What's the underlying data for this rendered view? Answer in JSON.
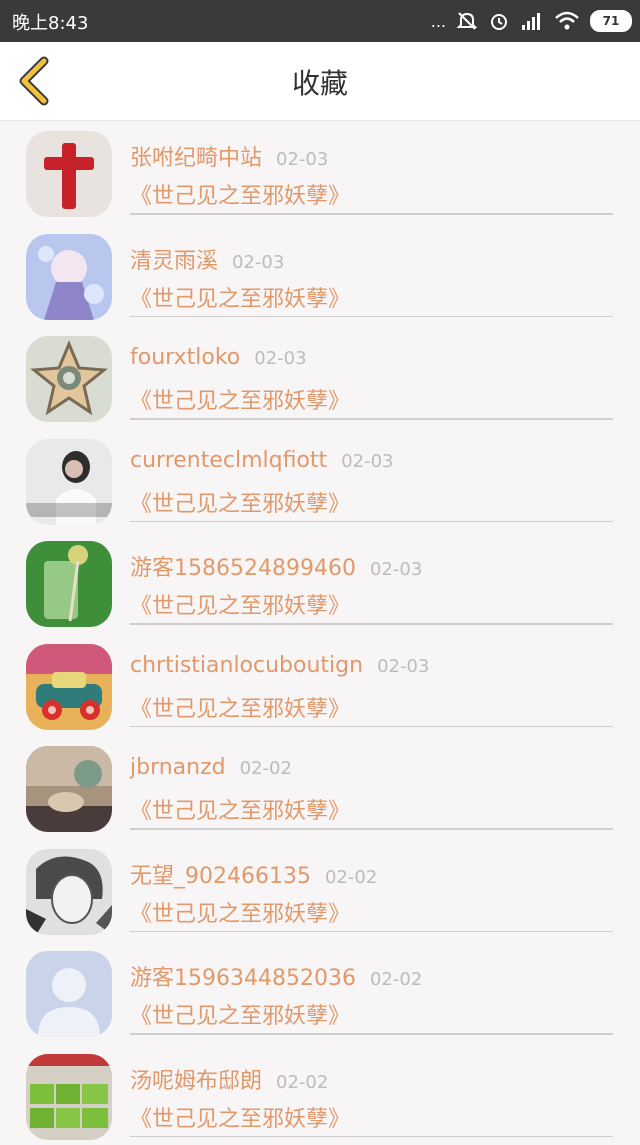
{
  "status_bar": {
    "time": "晚上8:43",
    "dots": "...",
    "battery": "71"
  },
  "header": {
    "title": "收藏"
  },
  "items": [
    {
      "name": "张咐纪畸中站",
      "date": "02-03",
      "book": "《世己见之至邪妖孽》",
      "avatar": "red-cross"
    },
    {
      "name": "清灵雨溪",
      "date": "02-03",
      "book": "《世己见之至邪妖孽》",
      "avatar": "anime-girl"
    },
    {
      "name": "fourxtloko",
      "date": "02-03",
      "book": "《世己见之至邪妖孽》",
      "avatar": "star-cookie"
    },
    {
      "name": "currenteclmlqfiott",
      "date": "02-03",
      "book": "《世己见之至邪妖孽》",
      "avatar": "woman-photo"
    },
    {
      "name": "游客1586524899460",
      "date": "02-03",
      "book": "《世己见之至邪妖孽》",
      "avatar": "green-drink"
    },
    {
      "name": "chrtistianlocuboutign",
      "date": "02-03",
      "book": "《世己见之至邪妖孽》",
      "avatar": "toy-car"
    },
    {
      "name": "jbrnanzd",
      "date": "02-02",
      "book": "《世己见之至邪妖孽》",
      "avatar": "blurred-photo"
    },
    {
      "name": "无望_902466135",
      "date": "02-02",
      "book": "《世己见之至邪妖孽》",
      "avatar": "sketch-boy"
    },
    {
      "name": "游客1596344852036",
      "date": "02-02",
      "book": "《世己见之至邪妖孽》",
      "avatar": "default-user"
    },
    {
      "name": "汤呢姆布邸朗",
      "date": "02-02",
      "book": "《世己见之至邪妖孽》",
      "avatar": "green-cake"
    }
  ]
}
